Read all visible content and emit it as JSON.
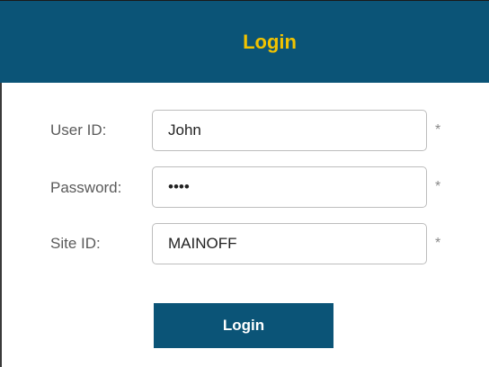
{
  "header": {
    "title": "Login"
  },
  "form": {
    "user_id": {
      "label": "User ID:",
      "value": "John",
      "required_mark": "*"
    },
    "password": {
      "label": "Password:",
      "value": "••••",
      "required_mark": "*"
    },
    "site_id": {
      "label": "Site ID:",
      "value": "MAINOFF",
      "required_mark": "*"
    },
    "submit_label": "Login"
  },
  "colors": {
    "header_bg": "#0b5477",
    "header_title": "#f2c300",
    "button_bg": "#0b5477",
    "button_text": "#ffffff"
  }
}
